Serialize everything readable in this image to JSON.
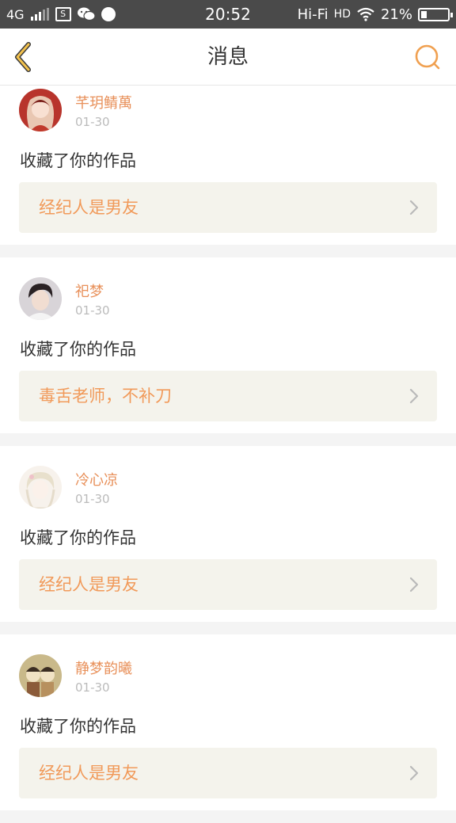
{
  "status_bar": {
    "network": "4G",
    "time": "20:52",
    "hifi": "Hi-Fi",
    "hd": "HD",
    "battery_percent": "21%",
    "battery_level": 0.21,
    "icons": [
      "signal-icon",
      "screenshot-icon",
      "wechat-icon",
      "app-notification-icon",
      "wifi-icon",
      "battery-icon"
    ]
  },
  "nav": {
    "title": "消息",
    "back_icon": "chevron-left-icon",
    "search_icon": "search-icon",
    "accent": "#f0a050"
  },
  "colors": {
    "username": "#e8905a",
    "work_title": "#f19a5a",
    "work_bg": "#f4f3ec",
    "divider": "#f4f4f4"
  },
  "messages": [
    {
      "username": "芊玥鲭萬",
      "date": "01-30",
      "action": "收藏了你的作品",
      "work_title": "经纪人是男友"
    },
    {
      "username": "祀梦",
      "date": "01-30",
      "action": "收藏了你的作品",
      "work_title": "毒舌老师，不补刀"
    },
    {
      "username": "冷心凉",
      "date": "01-30",
      "action": "收藏了你的作品",
      "work_title": "经纪人是男友"
    },
    {
      "username": "静梦韵曦",
      "date": "01-30",
      "action": "收藏了你的作品",
      "work_title": "经纪人是男友"
    }
  ]
}
